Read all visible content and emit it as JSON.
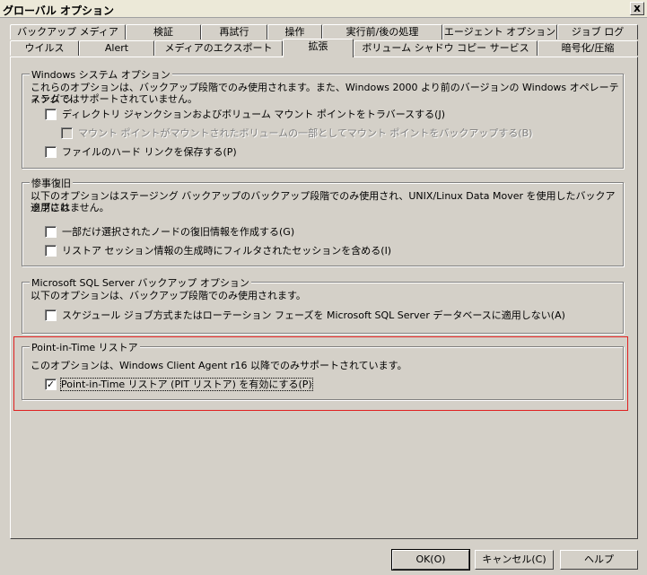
{
  "window": {
    "title": "グローバル オプション",
    "close_glyph": "x"
  },
  "tabs_row1": [
    "バックアップ メディア",
    "検証",
    "再試行",
    "操作",
    "実行前/後の処理",
    "エージェント オプション",
    "ジョブ ログ"
  ],
  "tabs_row2": [
    "ウイルス",
    "Alert",
    "メディアのエクスポート",
    "拡張",
    "ボリューム シャドウ コピー サービス",
    "暗号化/圧縮"
  ],
  "active_tab": "拡張",
  "groups": {
    "windows": {
      "legend": "Windows システム オプション",
      "desc1": "これらのオプションは、バックアップ段階でのみ使用されます。また、Windows 2000 より前のバージョンの Windows オペレーティング シ",
      "desc2": "ステムではサポートされていません。",
      "opt1": "ディレクトリ ジャンクションおよびボリューム マウント ポイントをトラバースする(J)",
      "opt2": "マウント ポイントがマウントされたボリュームの一部としてマウント ポイントをバックアップする(B)",
      "opt3": "ファイルのハード リンクを保存する(P)"
    },
    "disaster": {
      "legend": "惨事復旧",
      "desc1": "以下のオプションはステージング バックアップのバックアップ段階でのみ使用され、UNIX/Linux Data Mover を使用したバックアップには",
      "desc2": "適用されません。",
      "opt1": "一部だけ選択されたノードの復旧情報を作成する(G)",
      "opt2": "リストア セッション情報の生成時にフィルタされたセッションを含める(I)"
    },
    "sql": {
      "legend": "Microsoft SQL Server バックアップ オプション",
      "desc1": "以下のオプションは、バックアップ段階でのみ使用されます。",
      "opt1": "スケジュール ジョブ方式またはローテーション フェーズを Microsoft SQL Server データベースに適用しない(A)"
    },
    "pit": {
      "legend": "Point-in-Time リストア",
      "desc1": "このオプションは、Windows Client Agent r16 以降でのみサポートされています。",
      "opt1": "Point-in-Time リストア (PIT リストア) を有効にする(P)",
      "check_glyph": "✓"
    }
  },
  "buttons": {
    "ok": "OK(O)",
    "cancel": "キャンセル(C)",
    "help": "ヘルプ"
  },
  "colors": {
    "face": "#d4d0c8",
    "highlight_box": "#e02020"
  }
}
